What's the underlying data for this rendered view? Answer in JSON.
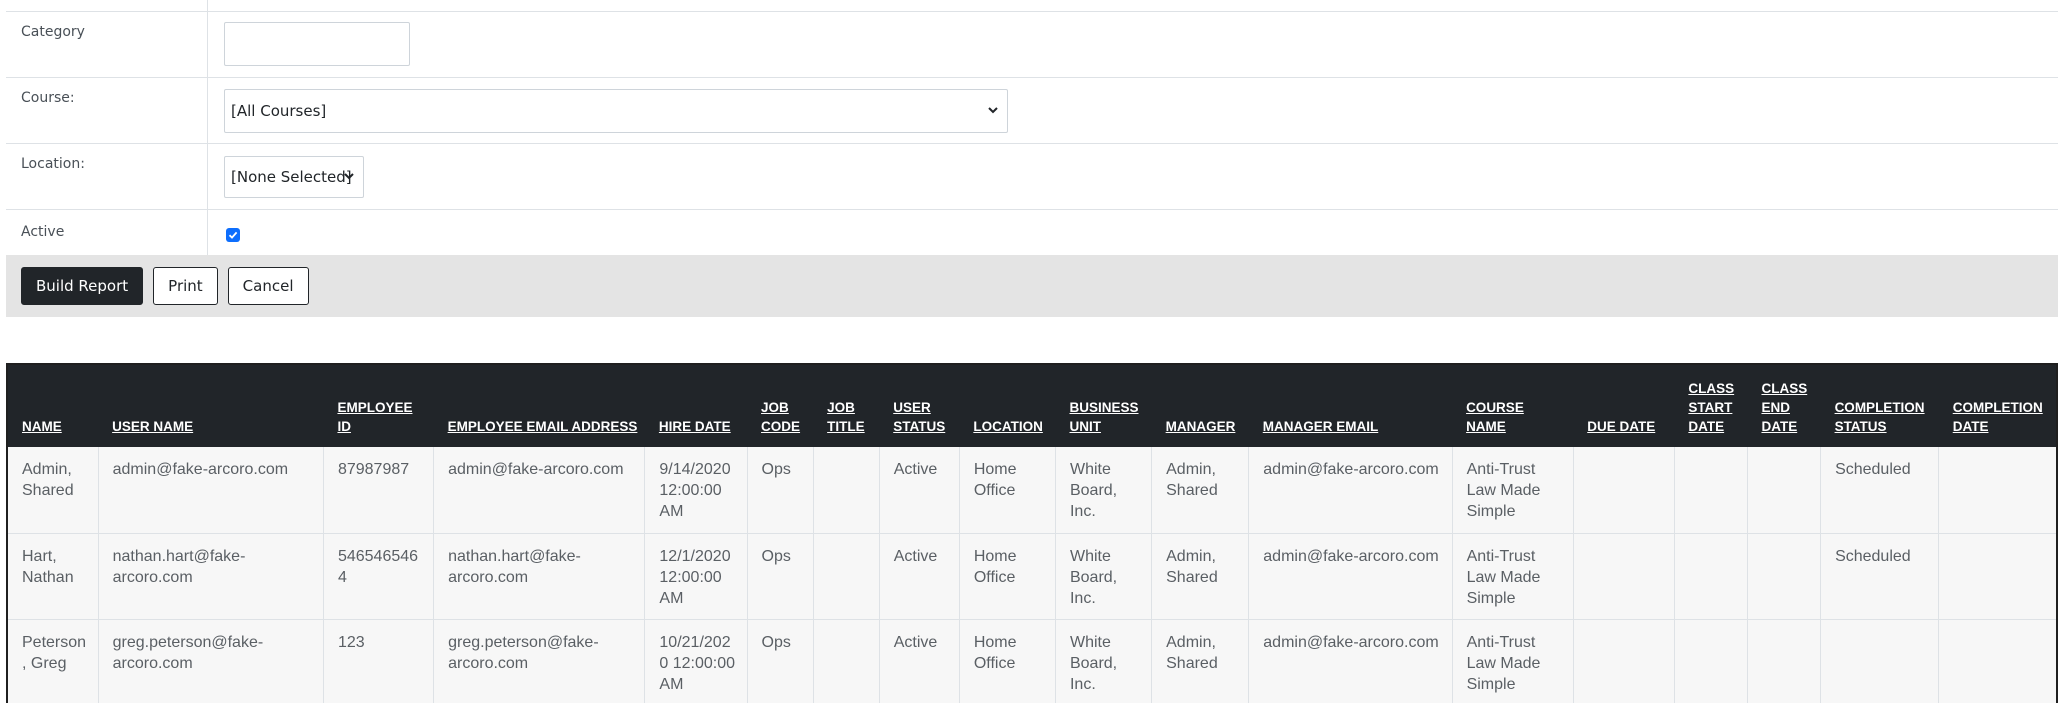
{
  "form": {
    "category_label": "Category",
    "category_value": "",
    "course_label": "Course:",
    "course_selected": "[All Courses]",
    "location_label": "Location:",
    "location_selected": "[None Selected]",
    "active_label": "Active",
    "active_checked": true
  },
  "buttons": {
    "build_report": "Build Report",
    "print": "Print",
    "cancel": "Cancel"
  },
  "colors": {
    "header_bg": "#212529",
    "checkbox": "#0d6efd",
    "button_bar": "#e4e4e4"
  },
  "table": {
    "columns": [
      {
        "key": "name",
        "label": "NAME"
      },
      {
        "key": "user_name",
        "label": "USER NAME"
      },
      {
        "key": "employee_id",
        "label": "EMPLOYEE ID"
      },
      {
        "key": "employee_email",
        "label": "EMPLOYEE EMAIL ADDRESS"
      },
      {
        "key": "hire_date",
        "label": "HIRE DATE"
      },
      {
        "key": "job_code",
        "label": "JOB CODE"
      },
      {
        "key": "job_title",
        "label": "JOB TITLE"
      },
      {
        "key": "user_status",
        "label": "USER STATUS"
      },
      {
        "key": "location",
        "label": "LOCATION"
      },
      {
        "key": "business_unit",
        "label": "BUSINESS UNIT"
      },
      {
        "key": "manager",
        "label": "MANAGER"
      },
      {
        "key": "manager_email",
        "label": "MANAGER EMAIL"
      },
      {
        "key": "course_name",
        "label": "COURSE NAME"
      },
      {
        "key": "due_date",
        "label": "DUE DATE"
      },
      {
        "key": "class_start_date",
        "label": "CLASS START DATE"
      },
      {
        "key": "class_end_date",
        "label": "CLASS END DATE"
      },
      {
        "key": "completion_status",
        "label": "COMPLETION STATUS"
      },
      {
        "key": "completion_date",
        "label": "COMPLETION DATE"
      }
    ],
    "rows": [
      [
        "Admin, Shared",
        "admin@fake-arcoro.com",
        "87987987",
        "admin@fake-arcoro.com",
        "9/14/2020 12:00:00 AM",
        "Ops",
        "",
        "Active",
        "Home Office",
        "White Board, Inc.",
        "Admin, Shared",
        "admin@fake-arcoro.com",
        "Anti-Trust Law Made Simple",
        "",
        "",
        "",
        "Scheduled",
        ""
      ],
      [
        "Hart, Nathan",
        "nathan.hart@fake-arcoro.com",
        "5465465464",
        "nathan.hart@fake-arcoro.com",
        "12/1/2020 12:00:00 AM",
        "Ops",
        "",
        "Active",
        "Home Office",
        "White Board, Inc.",
        "Admin, Shared",
        "admin@fake-arcoro.com",
        "Anti-Trust Law Made Simple",
        "",
        "",
        "",
        "Scheduled",
        ""
      ],
      [
        "Peterson, Greg",
        "greg.peterson@fake-arcoro.com",
        "123",
        "greg.peterson@fake-arcoro.com",
        "10/21/2020 12:00:00 AM",
        "Ops",
        "",
        "Active",
        "Home Office",
        "White Board, Inc.",
        "Admin, Shared",
        "admin@fake-arcoro.com",
        "Anti-Trust Law Made Simple",
        "",
        "",
        "",
        "",
        ""
      ]
    ]
  }
}
